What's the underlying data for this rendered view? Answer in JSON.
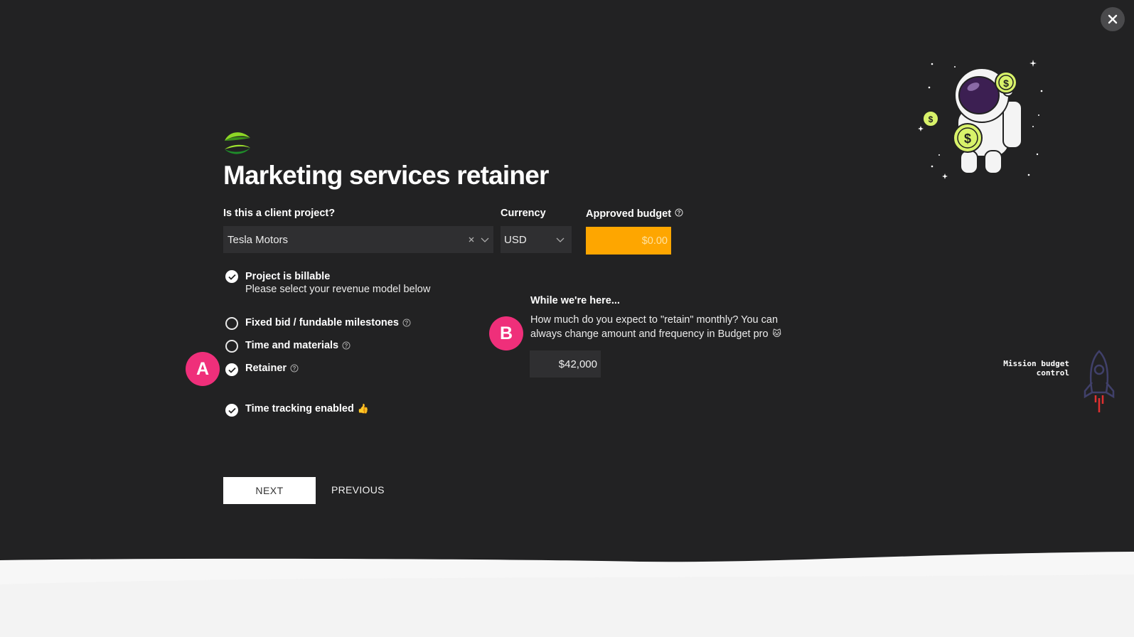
{
  "dialog": {
    "close_icon": "close-icon",
    "title": "Marketing services retainer"
  },
  "client_field": {
    "label": "Is this a client project?",
    "value": "Tesla Motors"
  },
  "currency_field": {
    "label": "Currency",
    "value": "USD"
  },
  "budget_field": {
    "label": "Approved budget",
    "value": "$0.00",
    "accent_color": "#fea600"
  },
  "billable": {
    "label": "Project is billable",
    "sublabel": "Please select your revenue model below",
    "checked": true
  },
  "revenue_models": [
    {
      "label": "Fixed bid / fundable milestones",
      "selected": false
    },
    {
      "label": "Time and materials",
      "selected": false
    },
    {
      "label": "Retainer",
      "selected": true
    }
  ],
  "time_tracking": {
    "label": "Time tracking enabled",
    "emoji": "👍",
    "checked": true
  },
  "badges": {
    "a": "A",
    "b": "B",
    "color": "#ef2f7a"
  },
  "retain_panel": {
    "heading": "While we're here...",
    "text_line1": "How much do you expect to \"retain\" monthly? You can",
    "text_line2": "always change amount and frequency in Budget pro",
    "emoji": "🐱",
    "amount": "$42,000"
  },
  "buttons": {
    "next": "NEXT",
    "previous": "PREVIOUS"
  },
  "mission": {
    "line1": "Mission budget",
    "line2": "control"
  }
}
